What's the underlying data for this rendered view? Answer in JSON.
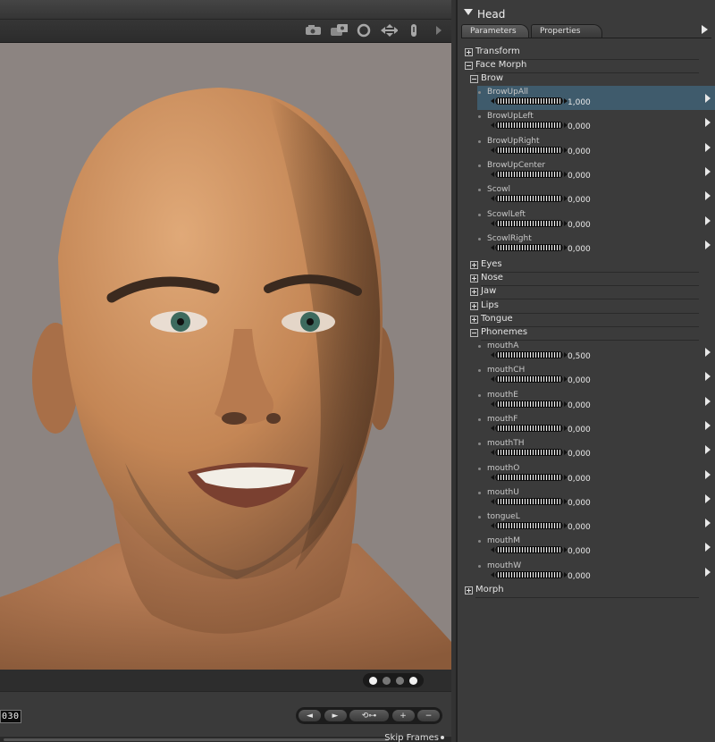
{
  "panel": {
    "title": "Head",
    "tabs": [
      {
        "label": "Parameters",
        "active": true
      },
      {
        "label": "Properties",
        "active": false
      }
    ],
    "groups": {
      "transform": {
        "label": "Transform",
        "expanded": false
      },
      "face_morph": {
        "label": "Face Morph",
        "expanded": true
      },
      "brow": {
        "label": "Brow",
        "expanded": true
      },
      "eyes": {
        "label": "Eyes",
        "expanded": false
      },
      "nose": {
        "label": "Nose",
        "expanded": false
      },
      "jaw": {
        "label": "Jaw",
        "expanded": false
      },
      "lips": {
        "label": "Lips",
        "expanded": false
      },
      "tongue": {
        "label": "Tongue",
        "expanded": false
      },
      "phonemes": {
        "label": "Phonemes",
        "expanded": true
      },
      "morph": {
        "label": "Morph",
        "expanded": false
      }
    },
    "brow_params": [
      {
        "name": "BrowUpAll",
        "value": "1,000",
        "selected": true
      },
      {
        "name": "BrowUpLeft",
        "value": "0,000"
      },
      {
        "name": "BrowUpRight",
        "value": "0,000"
      },
      {
        "name": "BrowUpCenter",
        "value": "0,000"
      },
      {
        "name": "Scowl",
        "value": "0,000"
      },
      {
        "name": "ScowlLeft",
        "value": "0,000"
      },
      {
        "name": "ScowlRight",
        "value": "0,000"
      }
    ],
    "phoneme_params": [
      {
        "name": "mouthA",
        "value": "0,500"
      },
      {
        "name": "mouthCH",
        "value": "0,000"
      },
      {
        "name": "mouthE",
        "value": "0,000"
      },
      {
        "name": "mouthF",
        "value": "0,000"
      },
      {
        "name": "mouthTH",
        "value": "0,000"
      },
      {
        "name": "mouthO",
        "value": "0,000"
      },
      {
        "name": "mouthU",
        "value": "0,000"
      },
      {
        "name": "tongueL",
        "value": "0,000"
      },
      {
        "name": "mouthM",
        "value": "0,000"
      },
      {
        "name": "mouthW",
        "value": "0,000"
      }
    ]
  },
  "timeline": {
    "frame": "030",
    "skip_frames_label": "Skip Frames",
    "buttons": {
      "prev": "◄",
      "next": "►",
      "key": "⟲⊶",
      "add": "+",
      "remove": "−"
    }
  },
  "viewport": {
    "background_color": "#8c8481",
    "skin_color": "#c98a58",
    "dots": [
      true,
      false,
      false,
      true
    ]
  }
}
